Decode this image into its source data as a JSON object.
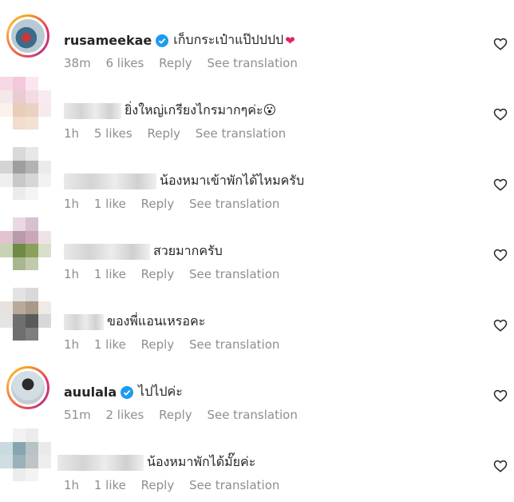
{
  "comments": [
    {
      "username": "rusameekae",
      "verified": true,
      "text": "เก็บกระเป๋าแป๊ปปปป",
      "emoji": "❤",
      "time": "38m",
      "likes": "6 likes",
      "reply": "Reply",
      "translate": "See translation"
    },
    {
      "username": "",
      "text": "ยิ่งใหญ่เกรียงไกรมากๆค่ะ😮",
      "time": "1h",
      "likes": "5 likes",
      "reply": "Reply",
      "translate": "See translation"
    },
    {
      "username": "",
      "text": "น้องหมาเข้าพักได้ไหมครับ",
      "time": "1h",
      "likes": "1 like",
      "reply": "Reply",
      "translate": "See translation"
    },
    {
      "username": "",
      "text": "สวยมากครับ",
      "time": "1h",
      "likes": "1 like",
      "reply": "Reply",
      "translate": "See translation"
    },
    {
      "username": "",
      "text": "ของพี่แอนเหรอคะ",
      "time": "1h",
      "likes": "1 like",
      "reply": "Reply",
      "translate": "See translation"
    },
    {
      "username": "auulala",
      "verified": true,
      "text": "ไปไปค่ะ",
      "time": "51m",
      "likes": "2 likes",
      "reply": "Reply",
      "translate": "See translation"
    },
    {
      "username": "",
      "text": "น้องหมาพักได้มั๊ยค่ะ",
      "time": "1h",
      "likes": "1 like",
      "reply": "Reply",
      "translate": "See translation"
    }
  ],
  "icons": {
    "heart": "heart-outline-icon",
    "verified": "verified-badge-icon"
  },
  "colors": {
    "verified": "#1d9bf0",
    "meta": "#8e8e8e",
    "text": "#262626"
  }
}
